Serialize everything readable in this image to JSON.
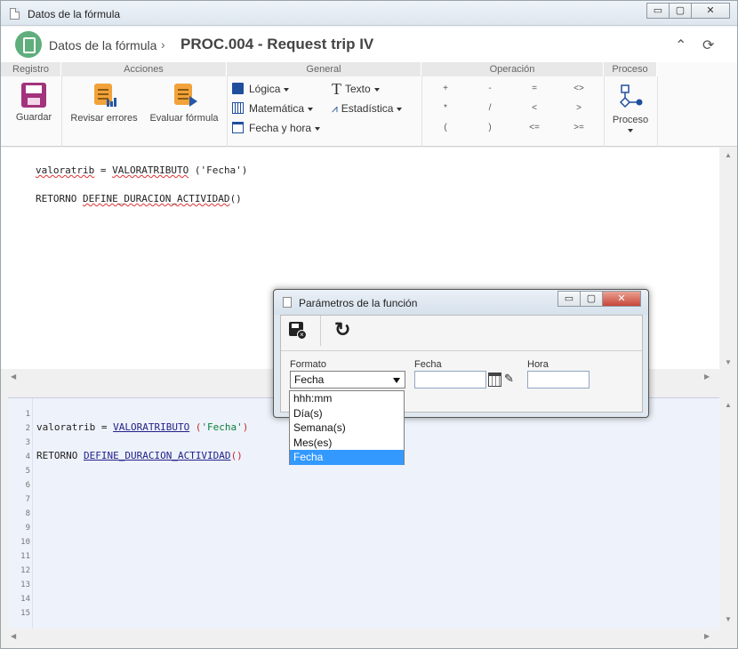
{
  "window": {
    "title": "Datos de la fórmula",
    "min": "▭",
    "max": "▢",
    "close": "✕"
  },
  "header": {
    "title": "Datos de la fórmula",
    "chevron": "›",
    "process": "PROC.004 - Request trip IV",
    "collapse_icon": "collapse-icon",
    "refresh_icon": "refresh-icon"
  },
  "ribbon": {
    "groups": {
      "registro": "Registro",
      "acciones": "Acciones",
      "general": "General",
      "operacion": "Operación",
      "proceso": "Proceso"
    },
    "guardar": "Guardar",
    "revisar": "Revisar errores",
    "evaluar": "Evaluar fórmula",
    "logica": "Lógica",
    "matematica": "Matemática",
    "fecha_hora": "Fecha y hora",
    "texto": "Texto",
    "estadistica": "Estadística",
    "proceso_btn": "Proceso",
    "operators": [
      "+",
      "-",
      "=",
      "<>",
      "*",
      "/",
      "<",
      ">",
      "(",
      ")",
      "<=",
      ">="
    ]
  },
  "editor_top": {
    "line1_var": "valoratrib",
    "line1_mid": " = ",
    "line1_fn": "VALORATRIBUTO",
    "line1_arg": " ('Fecha')",
    "line2_kw": "RETORNO ",
    "line2_fn": "DEFINE_DURACION_ACTIVIDAD",
    "line2_paren": "()"
  },
  "editor_bottom": {
    "line_numbers": [
      "1",
      "2",
      "3",
      "4",
      "5",
      "6",
      "7",
      "8",
      "9",
      "10",
      "11",
      "12",
      "13",
      "14",
      "15"
    ],
    "line2_var": "valoratrib = ",
    "line2_fn": "VALORATRIBUTO",
    "line2_open": " (",
    "line2_str": "'Fecha'",
    "line2_close": ")",
    "line4_kw": "RETORNO ",
    "line4_fn": "DEFINE_DURACION_ACTIVIDAD",
    "line4_paren": "()"
  },
  "dialog": {
    "title": "Parámetros de la función",
    "formato_label": "Formato",
    "formato_value": "Fecha",
    "fecha_label": "Fecha",
    "fecha_value": "",
    "hora_label": "Hora",
    "hora_value": "",
    "options": [
      "hhh:mm",
      "Día(s)",
      "Semana(s)",
      "Mes(es)",
      "Fecha"
    ],
    "selected_option": "Fecha"
  }
}
